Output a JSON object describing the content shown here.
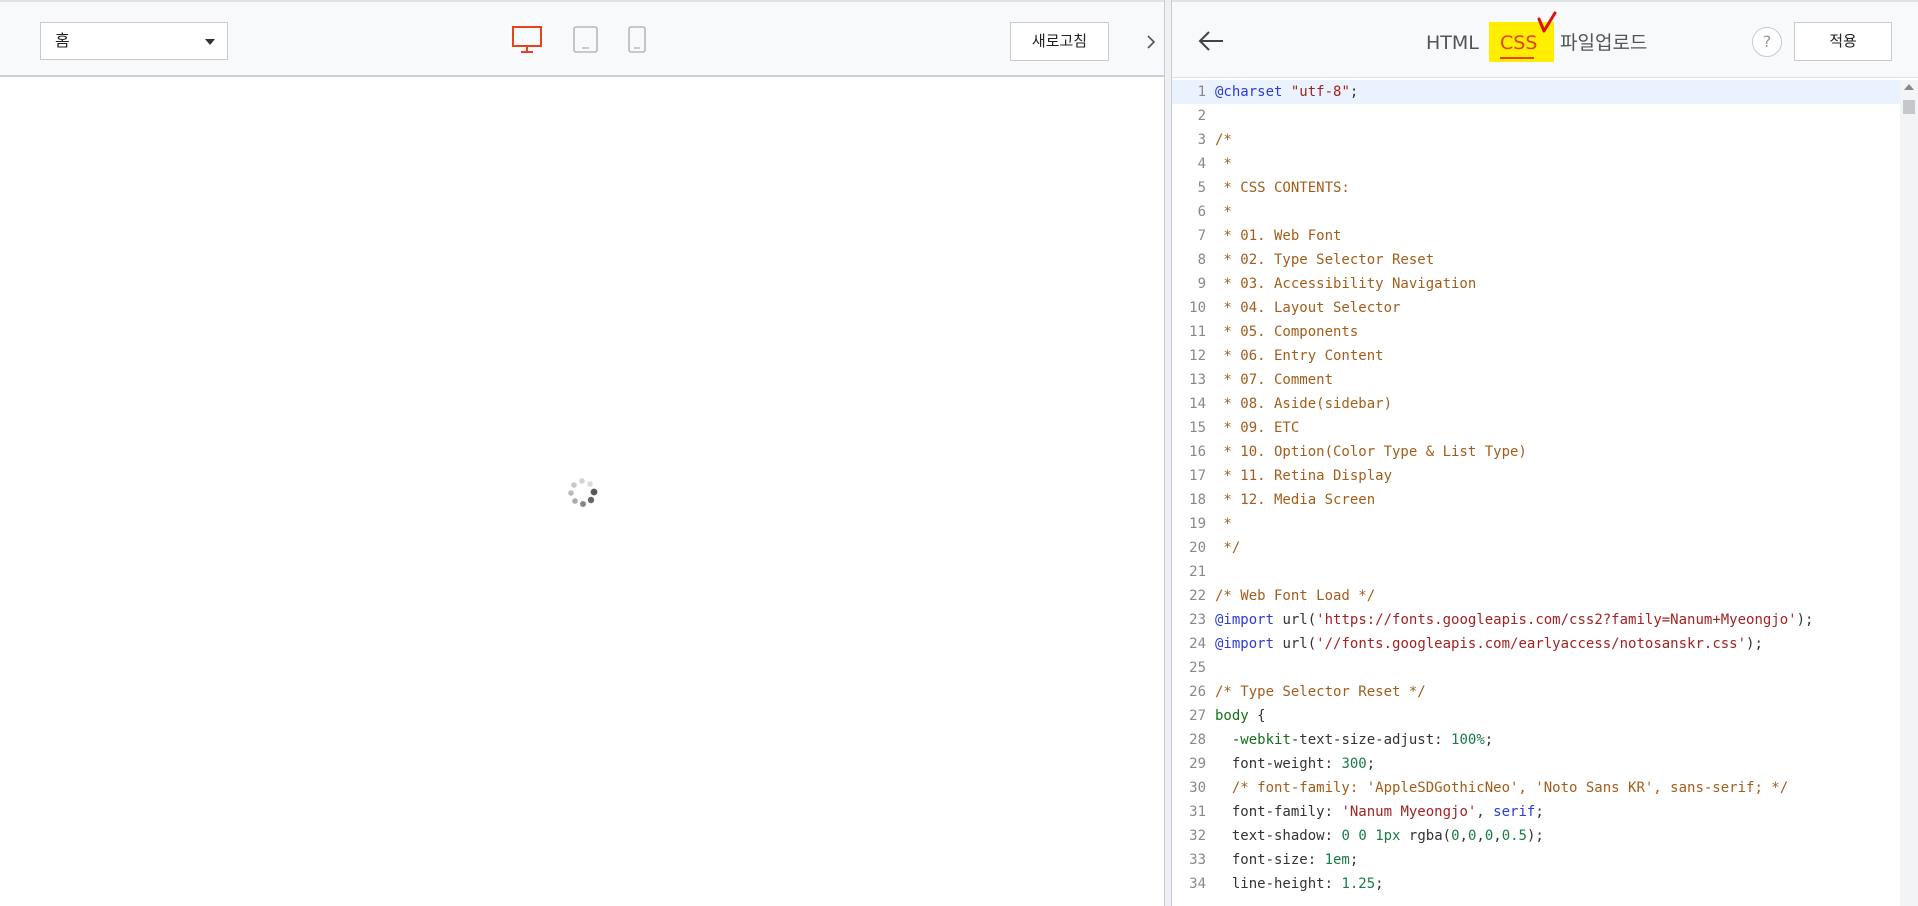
{
  "preview": {
    "page_select": "홈",
    "refresh_label": "새로고침",
    "devices": [
      "desktop-icon",
      "tablet-icon",
      "mobile-icon"
    ],
    "active_device_color": "#e8411f"
  },
  "editor": {
    "tabs": {
      "html": "HTML",
      "css": "CSS",
      "upload": "파일업로드"
    },
    "active_tab": "CSS",
    "help_label": "?",
    "apply_label": "적용",
    "highlight_color": "#ffee00",
    "accent_color": "#e8411f",
    "lines": [
      {
        "n": "1",
        "t": [
          [
            "at",
            "@charset"
          ],
          [
            "plain",
            " "
          ],
          [
            "str",
            "\"utf-8\""
          ],
          [
            "plain",
            ";"
          ]
        ]
      },
      {
        "n": "2",
        "t": []
      },
      {
        "n": "3",
        "t": [
          [
            "comment",
            "/*"
          ]
        ]
      },
      {
        "n": "4",
        "t": [
          [
            "comment",
            " *"
          ]
        ]
      },
      {
        "n": "5",
        "t": [
          [
            "comment",
            " * CSS CONTENTS:"
          ]
        ]
      },
      {
        "n": "6",
        "t": [
          [
            "comment",
            " *"
          ]
        ]
      },
      {
        "n": "7",
        "t": [
          [
            "comment",
            " * 01. Web Font"
          ]
        ]
      },
      {
        "n": "8",
        "t": [
          [
            "comment",
            " * 02. Type Selector Reset"
          ]
        ]
      },
      {
        "n": "9",
        "t": [
          [
            "comment",
            " * 03. Accessibility Navigation"
          ]
        ]
      },
      {
        "n": "10",
        "t": [
          [
            "comment",
            " * 04. Layout Selector"
          ]
        ]
      },
      {
        "n": "11",
        "t": [
          [
            "comment",
            " * 05. Components"
          ]
        ]
      },
      {
        "n": "12",
        "t": [
          [
            "comment",
            " * 06. Entry Content"
          ]
        ]
      },
      {
        "n": "13",
        "t": [
          [
            "comment",
            " * 07. Comment"
          ]
        ]
      },
      {
        "n": "14",
        "t": [
          [
            "comment",
            " * 08. Aside(sidebar)"
          ]
        ]
      },
      {
        "n": "15",
        "t": [
          [
            "comment",
            " * 09. ETC"
          ]
        ]
      },
      {
        "n": "16",
        "t": [
          [
            "comment",
            " * 10. Option(Color Type & List Type)"
          ]
        ]
      },
      {
        "n": "17",
        "t": [
          [
            "comment",
            " * 11. Retina Display"
          ]
        ]
      },
      {
        "n": "18",
        "t": [
          [
            "comment",
            " * 12. Media Screen"
          ]
        ]
      },
      {
        "n": "19",
        "t": [
          [
            "comment",
            " *"
          ]
        ]
      },
      {
        "n": "20",
        "t": [
          [
            "comment",
            " */"
          ]
        ]
      },
      {
        "n": "21",
        "t": []
      },
      {
        "n": "22",
        "t": [
          [
            "comment",
            "/* Web Font Load */"
          ]
        ]
      },
      {
        "n": "23",
        "t": [
          [
            "at",
            "@import"
          ],
          [
            "plain",
            " url("
          ],
          [
            "str",
            "'https://fonts.googleapis.com/css2?family=Nanum+Myeongjo'"
          ],
          [
            "plain",
            ");"
          ]
        ]
      },
      {
        "n": "24",
        "t": [
          [
            "at",
            "@import"
          ],
          [
            "plain",
            " url("
          ],
          [
            "str",
            "'//fonts.googleapis.com/earlyaccess/notosanskr.css'"
          ],
          [
            "plain",
            ");"
          ]
        ]
      },
      {
        "n": "25",
        "t": []
      },
      {
        "n": "26",
        "t": [
          [
            "comment",
            "/* Type Selector Reset */"
          ]
        ]
      },
      {
        "n": "27",
        "t": [
          [
            "sel",
            "body"
          ],
          [
            "plain",
            " {"
          ]
        ]
      },
      {
        "n": "28",
        "t": [
          [
            "plain",
            "  -"
          ],
          [
            "sel",
            "webkit"
          ],
          [
            "plain",
            "-text-size-adjust: "
          ],
          [
            "num",
            "100%"
          ],
          [
            "plain",
            ";"
          ]
        ]
      },
      {
        "n": "29",
        "t": [
          [
            "plain",
            "  font-weight: "
          ],
          [
            "num",
            "300"
          ],
          [
            "plain",
            ";"
          ]
        ]
      },
      {
        "n": "30",
        "t": [
          [
            "plain",
            "  "
          ],
          [
            "comment",
            "/* font-family: 'AppleSDGothicNeo', 'Noto Sans KR', sans-serif; */"
          ]
        ]
      },
      {
        "n": "31",
        "t": [
          [
            "plain",
            "  font-family: "
          ],
          [
            "str",
            "'Nanum Myeongjo'"
          ],
          [
            "plain",
            ", "
          ],
          [
            "kw",
            "serif"
          ],
          [
            "plain",
            ";"
          ]
        ]
      },
      {
        "n": "32",
        "t": [
          [
            "plain",
            "  text-shadow: "
          ],
          [
            "num",
            "0"
          ],
          [
            "plain",
            " "
          ],
          [
            "num",
            "0"
          ],
          [
            "plain",
            " "
          ],
          [
            "num",
            "1px"
          ],
          [
            "plain",
            " rgba("
          ],
          [
            "num",
            "0"
          ],
          [
            "plain",
            ","
          ],
          [
            "num",
            "0"
          ],
          [
            "plain",
            ","
          ],
          [
            "num",
            "0"
          ],
          [
            "plain",
            ","
          ],
          [
            "num",
            "0.5"
          ],
          [
            "plain",
            ");"
          ]
        ]
      },
      {
        "n": "33",
        "t": [
          [
            "plain",
            "  font-size: "
          ],
          [
            "num",
            "1em"
          ],
          [
            "plain",
            ";"
          ]
        ]
      },
      {
        "n": "34",
        "t": [
          [
            "plain",
            "  line-height: "
          ],
          [
            "num",
            "1.25"
          ],
          [
            "plain",
            ";"
          ]
        ]
      }
    ]
  }
}
